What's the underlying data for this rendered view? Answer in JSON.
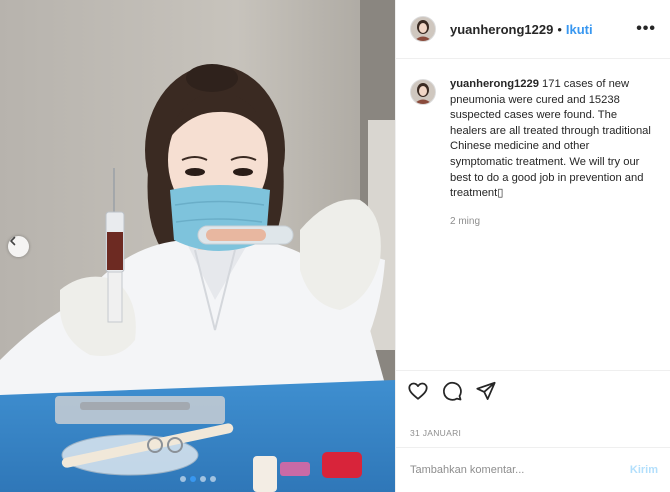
{
  "header": {
    "username": "yuanherong1229",
    "separator": "•",
    "follow_label": "Ikuti",
    "more_label": "•••"
  },
  "caption": {
    "username": "yuanherong1229",
    "text": "171 cases of new pneumonia were cured and 15238 suspected cases were found. The healers are all treated through traditional Chinese medicine and other symptomatic treatment. We will try our best to do a good job in prevention and treatment▯",
    "time": "2 ming"
  },
  "actions": {
    "like_icon": "heart-icon",
    "comment_icon": "comment-icon",
    "share_icon": "share-icon"
  },
  "date": "31 JANUARI",
  "comment": {
    "placeholder": "Tambahkan komentar...",
    "post_label": "Kirim"
  },
  "carousel": {
    "prev_icon": "chevron-left-icon",
    "slide_count": 4,
    "active_index": 1
  },
  "colors": {
    "accent": "#3897f0",
    "post_disabled": "#b2dffc",
    "muted": "#8e8e8e",
    "border": "#efefef"
  }
}
